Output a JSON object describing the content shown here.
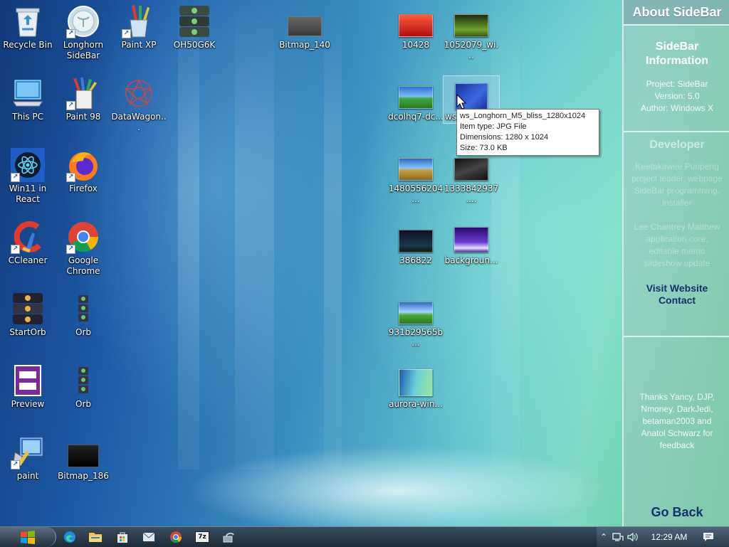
{
  "desktop": {
    "icons": [
      {
        "label": "Recycle Bin",
        "icon": "recycle-bin-icon",
        "shortcut": false
      },
      {
        "label": "Longhorn SideBar",
        "icon": "longhorn-sidebar-icon",
        "shortcut": true
      },
      {
        "label": "Paint XP",
        "icon": "paint-xp-icon",
        "shortcut": true
      },
      {
        "label": "OH50G6K",
        "icon": "orb-strip-icon",
        "shortcut": false
      },
      {
        "label": "Bitmap_140",
        "icon": "bitmap-icon",
        "shortcut": false
      },
      {
        "label": "10428",
        "icon": "image-thumb-icon",
        "shortcut": false
      },
      {
        "label": "1052079_wi...",
        "icon": "image-thumb-icon",
        "shortcut": false
      },
      {
        "label": "This PC",
        "icon": "this-pc-icon",
        "shortcut": false
      },
      {
        "label": "Paint 98",
        "icon": "paint-98-icon",
        "shortcut": true
      },
      {
        "label": "DataWagon...",
        "icon": "datawagon-icon",
        "shortcut": false
      },
      {
        "label": "dcolhq7-dc...",
        "icon": "image-thumb-icon",
        "shortcut": false
      },
      {
        "label": "ws",
        "icon": "image-thumb-icon",
        "shortcut": false
      },
      {
        "label": "Win11 in React",
        "icon": "react-icon",
        "shortcut": true
      },
      {
        "label": "Firefox",
        "icon": "firefox-icon",
        "shortcut": true
      },
      {
        "label": "1480556204...",
        "icon": "image-thumb-icon",
        "shortcut": false
      },
      {
        "label": "1333842937....",
        "icon": "image-thumb-icon",
        "shortcut": false
      },
      {
        "label": "CCleaner",
        "icon": "ccleaner-icon",
        "shortcut": true
      },
      {
        "label": "Google Chrome",
        "icon": "chrome-icon",
        "shortcut": true
      },
      {
        "label": "386822",
        "icon": "image-thumb-icon",
        "shortcut": false
      },
      {
        "label": "backgroun...",
        "icon": "image-thumb-icon",
        "shortcut": false
      },
      {
        "label": "StartOrb",
        "icon": "orb-strip-icon",
        "shortcut": false
      },
      {
        "label": "Orb",
        "icon": "orb-strip-icon",
        "shortcut": false
      },
      {
        "label": "931b29565b...",
        "icon": "image-thumb-icon",
        "shortcut": false
      },
      {
        "label": "Preview",
        "icon": "preview-icon",
        "shortcut": false
      },
      {
        "label": "Orb",
        "icon": "orb-strip-icon",
        "shortcut": false
      },
      {
        "label": "aurora-win...",
        "icon": "image-thumb-icon",
        "shortcut": false
      },
      {
        "label": "paint",
        "icon": "paint-icon",
        "shortcut": true
      },
      {
        "label": "Bitmap_186",
        "icon": "bitmap-icon",
        "shortcut": false
      }
    ]
  },
  "tooltip": {
    "name": "ws_Longhorn_M5_bliss_1280x1024",
    "type": "Item type: JPG File",
    "dimensions": "Dimensions: 1280 x 1024",
    "size": "Size: 73.0 KB"
  },
  "sidebar": {
    "header": "About SideBar",
    "info_title": "SideBar Information",
    "project": "Project: SideBar",
    "version": "Version: 5.0",
    "author": "Author: Windows X",
    "developer_title": "Developer",
    "dev1": "Keetakawee Punpeng project leader, webpage SideBar programming, installer",
    "dev2": "Lee Chantrey Matthew application core, editable memo slideshow update",
    "visit_website": "Visit Website",
    "contact": "Contact",
    "thanks": "Thanks Yancy, DJP, Nmoney, DarkJedi, betaman2003 and Anatol Schwarz for feedback",
    "go_back": "Go Back"
  },
  "taskbar": {
    "items": [
      "edge-icon",
      "file-explorer-icon",
      "store-icon",
      "mail-icon",
      "chrome-icon",
      "7zip-icon",
      "network-tool-icon"
    ],
    "seven_zip_label": "7z",
    "clock": "12:29 AM"
  },
  "colors": {
    "sidebar_link": "#17306a",
    "tooltip_border": "#767676"
  }
}
